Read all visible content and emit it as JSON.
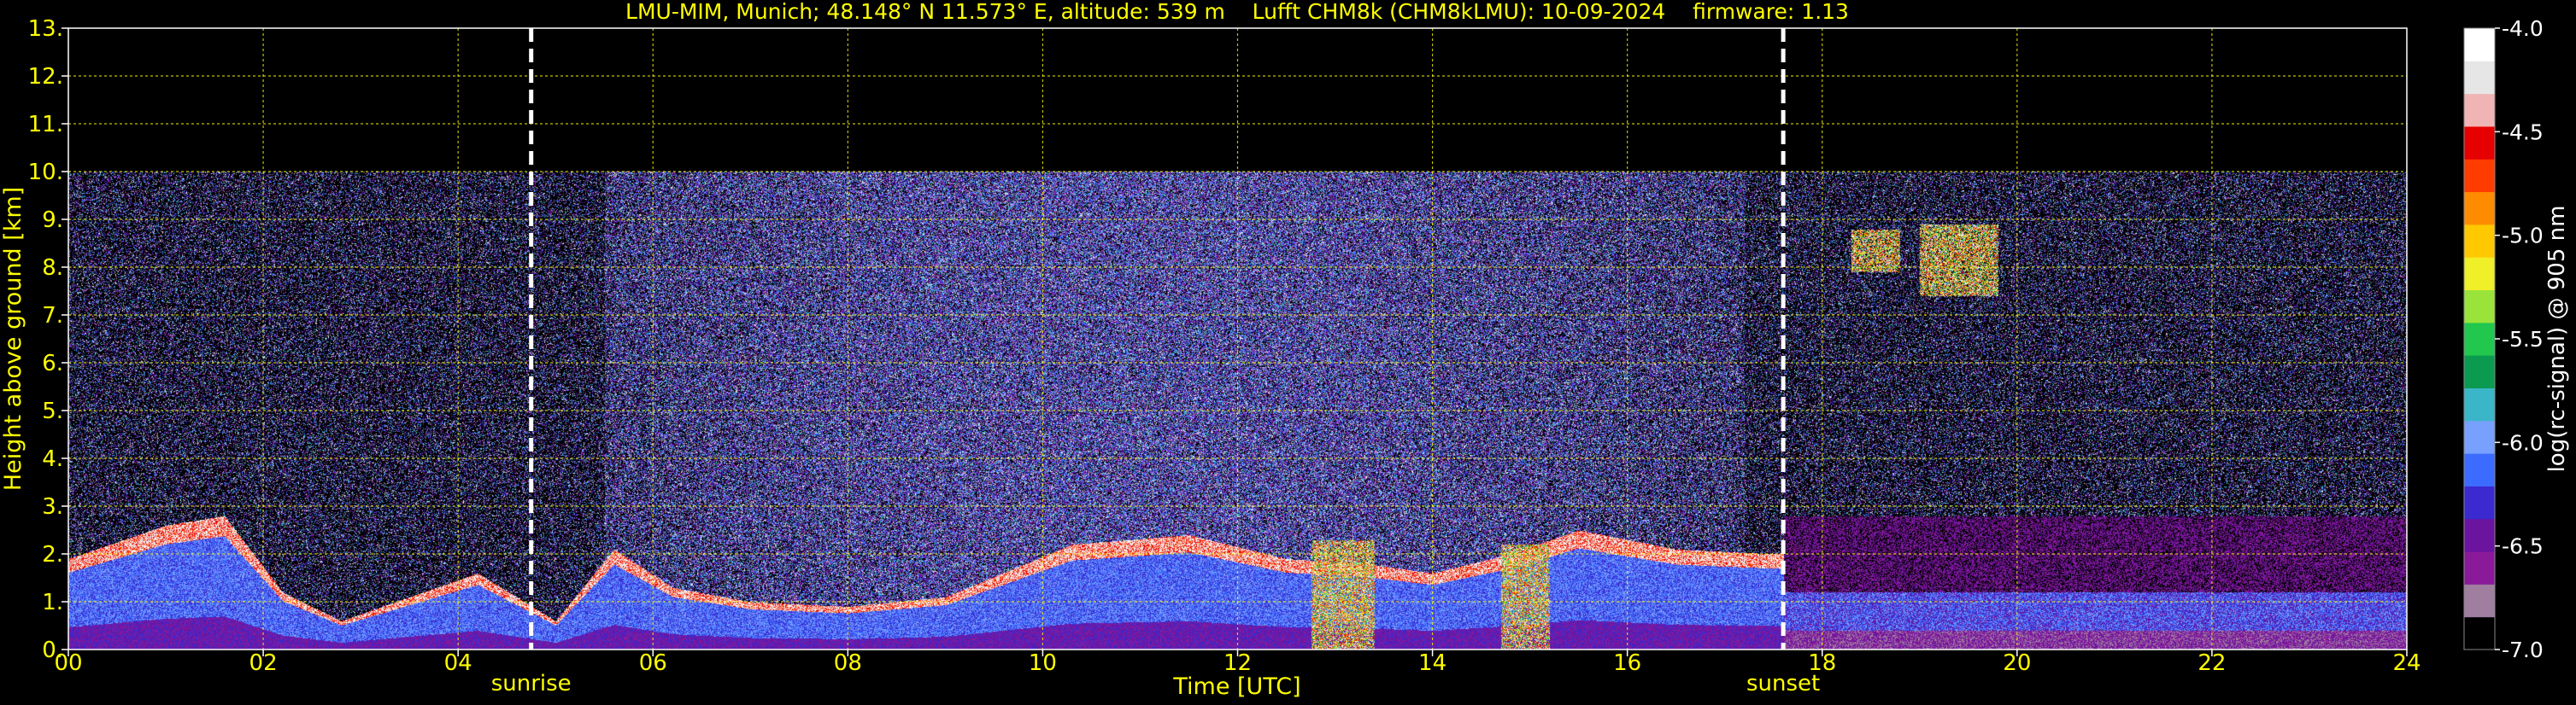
{
  "chart_data": {
    "type": "heatmap",
    "title": "LMU-MIM, Munich; 48.148° N 11.573° E, altitude: 539 m    Lufft CHM8k (CHM8kLMU): 10-09-2024    firmware: 1.13",
    "xlabel": "Time [UTC]",
    "ylabel": "Height above ground [km]",
    "colorbar_label": "log(rc-signal) @ 905 nm",
    "xlim": [
      0,
      24
    ],
    "ylim": [
      0,
      13
    ],
    "xticks": [
      "00",
      "02",
      "04",
      "06",
      "08",
      "10",
      "12",
      "14",
      "16",
      "18",
      "20",
      "22",
      "24"
    ],
    "yticks": [
      "0.",
      "1.",
      "2.",
      "3.",
      "4.",
      "5.",
      "6.",
      "7.",
      "8.",
      "9.",
      "10.",
      "11.",
      "12.",
      "13."
    ],
    "colorbar_range": [
      -7.0,
      -4.0
    ],
    "colorbar_ticks": [
      "-4.0",
      "-4.5",
      "-5.0",
      "-5.5",
      "-6.0",
      "-6.5",
      "-7.0"
    ],
    "grid": true,
    "data_ceiling_km": 10,
    "markers": [
      {
        "label": "sunrise",
        "time": 4.75
      },
      {
        "label": "sunset",
        "time": 17.6
      }
    ],
    "boundary_layer_top_km": [
      [
        0.0,
        1.9
      ],
      [
        1.0,
        2.6
      ],
      [
        1.6,
        2.8
      ],
      [
        2.2,
        1.2
      ],
      [
        2.8,
        0.6
      ],
      [
        3.5,
        1.1
      ],
      [
        4.2,
        1.6
      ],
      [
        5.0,
        0.6
      ],
      [
        5.6,
        2.1
      ],
      [
        6.2,
        1.3
      ],
      [
        7.0,
        1.0
      ],
      [
        8.0,
        0.9
      ],
      [
        9.0,
        1.1
      ],
      [
        10.3,
        2.2
      ],
      [
        11.5,
        2.4
      ],
      [
        12.5,
        1.9
      ],
      [
        13.3,
        1.8
      ],
      [
        14.0,
        1.6
      ],
      [
        14.8,
        2.0
      ],
      [
        15.5,
        2.5
      ],
      [
        16.5,
        2.1
      ],
      [
        17.5,
        2.0
      ]
    ],
    "cloud_events": [
      {
        "t0": 12.75,
        "t1": 13.4,
        "h0": 0.0,
        "h1": 2.3
      },
      {
        "t0": 14.7,
        "t1": 15.2,
        "h0": 0.0,
        "h1": 2.2
      },
      {
        "t0": 18.3,
        "t1": 18.8,
        "h0": 7.9,
        "h1": 8.8
      },
      {
        "t0": 19.0,
        "t1": 19.8,
        "h0": 7.4,
        "h1": 8.9
      }
    ],
    "colormap": [
      "#000000",
      "#a07ea0",
      "#8a1a9a",
      "#6a14a0",
      "#3a2ad0",
      "#3c6cff",
      "#78a0ff",
      "#3ab6c8",
      "#0a9a50",
      "#22c84e",
      "#9ae33a",
      "#f0f028",
      "#ffc800",
      "#ff8c00",
      "#ff3c00",
      "#e60000",
      "#f0b4b4",
      "#e6e6e6",
      "#ffffff"
    ]
  }
}
